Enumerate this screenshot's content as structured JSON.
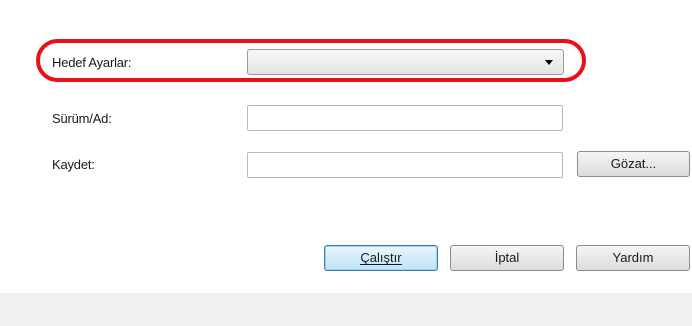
{
  "form": {
    "target_settings": {
      "label": "Hedef Ayarlar:",
      "value": ""
    },
    "version_name": {
      "label": "Sürüm/Ad:",
      "value": ""
    },
    "save": {
      "label": "Kaydet:",
      "value": ""
    }
  },
  "buttons": {
    "browse": "Gözat...",
    "run": "Çalıştır",
    "cancel": "İptal",
    "help": "Yardım"
  },
  "colors": {
    "highlight": "#e8101a",
    "default_button_border": "#3c7fb1",
    "bottom_band": "#f0f0f0"
  },
  "icons": {
    "dropdown": "chevron-down-icon"
  }
}
